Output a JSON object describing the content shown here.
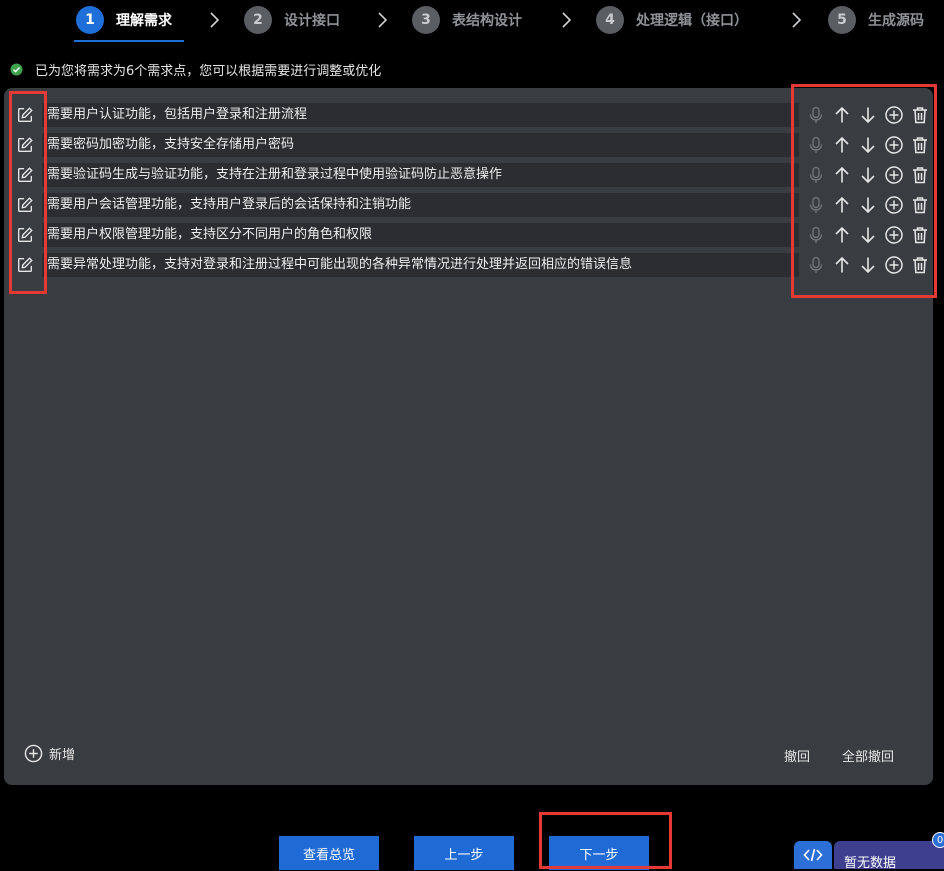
{
  "steps": [
    {
      "num": "1",
      "label": "理解需求",
      "active": true
    },
    {
      "num": "2",
      "label": "设计接口",
      "active": false
    },
    {
      "num": "3",
      "label": "表结构设计",
      "active": false
    },
    {
      "num": "4",
      "label": "处理逻辑（接口）",
      "active": false
    },
    {
      "num": "5",
      "label": "生成源码",
      "active": false
    }
  ],
  "info": {
    "text": "已为您将需求为6个需求点，您可以根据需要进行调整或优化",
    "icon": "check-circle-icon",
    "color": "#3fa34d"
  },
  "requirements": [
    "需要用户认证功能，包括用户登录和注册流程",
    "需要密码加密功能，支持安全存储用户密码",
    "需要验证码生成与验证功能，支持在注册和登录过程中使用验证码防止恶意操作",
    "需要用户会话管理功能，支持用户登录后的会话保持和注销功能",
    "需要用户权限管理功能，支持区分不同用户的角色和权限",
    "需要异常处理功能，支持对登录和注册过程中可能出现的各种异常情况进行处理并返回相应的错误信息"
  ],
  "panel": {
    "add_label": "新增",
    "undo_label": "撤回",
    "undo_all_label": "全部撤回"
  },
  "footer": {
    "overview_label": "查看总览",
    "prev_label": "上一步",
    "next_label": "下一步",
    "no_data_label": "暂无数据",
    "badge": "0"
  },
  "colors": {
    "accent": "#1e6fd8",
    "highlight": "#e53935",
    "panel": "#393c40"
  }
}
